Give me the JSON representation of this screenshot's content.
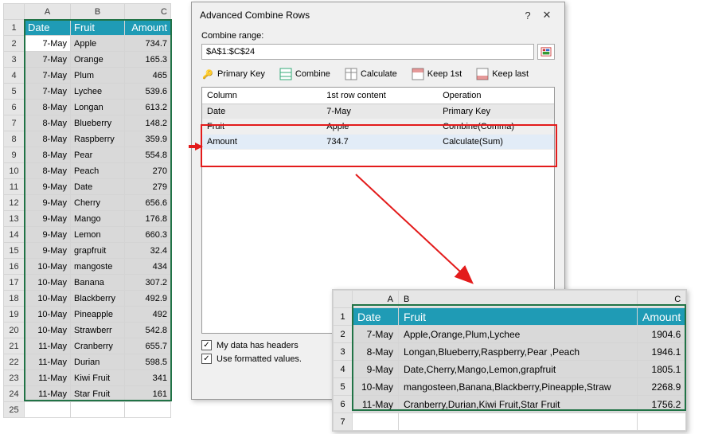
{
  "sheet": {
    "cols": [
      "A",
      "B",
      "C"
    ],
    "header": [
      "Date",
      "Fruit",
      "Amount"
    ],
    "rows": [
      [
        "7-May",
        "Apple",
        "734.7"
      ],
      [
        "7-May",
        "Orange",
        "165.3"
      ],
      [
        "7-May",
        "Plum",
        "465"
      ],
      [
        "7-May",
        "Lychee",
        "539.6"
      ],
      [
        "8-May",
        "Longan",
        "613.2"
      ],
      [
        "8-May",
        "Blueberry",
        "148.2"
      ],
      [
        "8-May",
        "Raspberry",
        "359.9"
      ],
      [
        "8-May",
        "Pear",
        "554.8"
      ],
      [
        "8-May",
        "Peach",
        "270"
      ],
      [
        "9-May",
        "Date",
        "279"
      ],
      [
        "9-May",
        "Cherry",
        "656.6"
      ],
      [
        "9-May",
        "Mango",
        "176.8"
      ],
      [
        "9-May",
        "Lemon",
        "660.3"
      ],
      [
        "9-May",
        "grapfruit",
        "32.4"
      ],
      [
        "10-May",
        "mangoste",
        "434"
      ],
      [
        "10-May",
        "Banana",
        "307.2"
      ],
      [
        "10-May",
        "Blackberry",
        "492.9"
      ],
      [
        "10-May",
        "Pineapple",
        "492"
      ],
      [
        "10-May",
        "Strawberr",
        "542.8"
      ],
      [
        "11-May",
        "Cranberry",
        "655.7"
      ],
      [
        "11-May",
        "Durian",
        "598.5"
      ],
      [
        "11-May",
        "Kiwi Fruit",
        "341"
      ],
      [
        "11-May",
        "Star Fruit",
        "161"
      ]
    ]
  },
  "dialog": {
    "title": "Advanced Combine Rows",
    "range_label": "Combine range:",
    "range_value": "$A$1:$C$24",
    "toolbar": {
      "primary": "Primary Key",
      "combine": "Combine",
      "calculate": "Calculate",
      "keep1st": "Keep 1st",
      "keeplast": "Keep last"
    },
    "cols": {
      "h1": "Column",
      "h2": "1st row content",
      "h3": "Operation",
      "rows": [
        [
          "Date",
          "7-May",
          "Primary Key"
        ],
        [
          "Fruit",
          "Apple",
          "Combine(Comma)"
        ],
        [
          "Amount",
          "734.7",
          "Calculate(Sum)"
        ]
      ]
    },
    "chk1": "My data has headers",
    "chk2": "Use formatted values."
  },
  "result": {
    "cols": [
      "A",
      "B",
      "C"
    ],
    "header": [
      "Date",
      "Fruit",
      "Amount"
    ],
    "rows": [
      [
        "7-May",
        "Apple,Orange,Plum,Lychee",
        "1904.6"
      ],
      [
        "8-May",
        "Longan,Blueberry,Raspberry,Pear ,Peach",
        "1946.1"
      ],
      [
        "9-May",
        "Date,Cherry,Mango,Lemon,grapfruit",
        "1805.1"
      ],
      [
        "10-May",
        "mangosteen,Banana,Blackberry,Pineapple,Straw",
        "2268.9"
      ],
      [
        "11-May",
        "Cranberry,Durian,Kiwi Fruit,Star Fruit",
        "1756.2"
      ]
    ]
  }
}
